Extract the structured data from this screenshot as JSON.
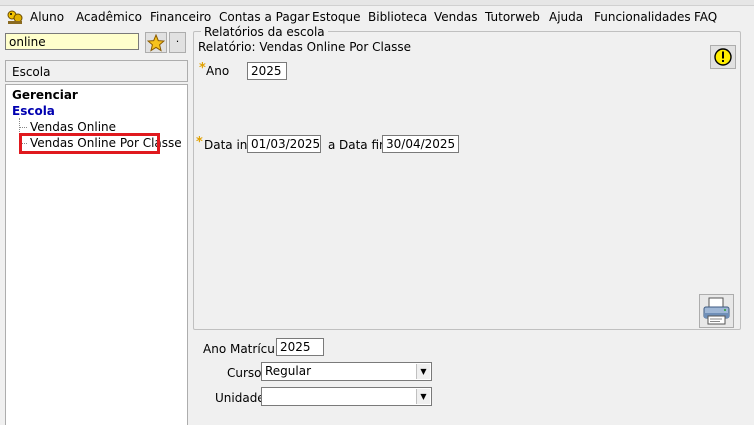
{
  "menu": {
    "items": [
      {
        "label": "Aluno"
      },
      {
        "label": "Acadêmico"
      },
      {
        "label": "Financeiro"
      },
      {
        "label": "Contas a Pagar"
      },
      {
        "label": "Estoque"
      },
      {
        "label": "Biblioteca"
      },
      {
        "label": "Vendas"
      },
      {
        "label": "Tutorweb"
      },
      {
        "label": "Ajuda"
      },
      {
        "label": "Funcionalidades"
      },
      {
        "label": "FAQ"
      }
    ]
  },
  "sidebar": {
    "search_value": "online",
    "more_button": "·",
    "header": "Escola",
    "tree": {
      "root": "Gerenciar",
      "group": "Escola",
      "items": [
        {
          "label": "Vendas Online"
        },
        {
          "label": "Vendas Online Por Classe"
        }
      ]
    }
  },
  "report": {
    "group_title": "Relatórios da escola",
    "subtitle": "Relatório: Vendas Online Por Classe",
    "required_mark": "*",
    "ano_label": "Ano",
    "ano_value": "2025",
    "data_ini_label": "Data ini",
    "data_ini_value": "01/03/2025",
    "a_label": "a",
    "data_fim_label": "Data fim",
    "data_fim_value": "30/04/2025"
  },
  "filters": {
    "ano_matricula_label": "Ano Matrícula",
    "ano_matricula_value": "2025",
    "curso_label": "Curso",
    "curso_value": "Regular",
    "unidade_label": "Unidade",
    "unidade_value": ""
  },
  "colors": {
    "search_bg": "#ffffcc",
    "highlight": "#e0191e",
    "tree_group": "#0000b0",
    "required": "#e0a000"
  },
  "icons": [
    "app-logo-icon",
    "star-icon",
    "warning-icon",
    "printer-icon",
    "chevron-down-icon"
  ]
}
